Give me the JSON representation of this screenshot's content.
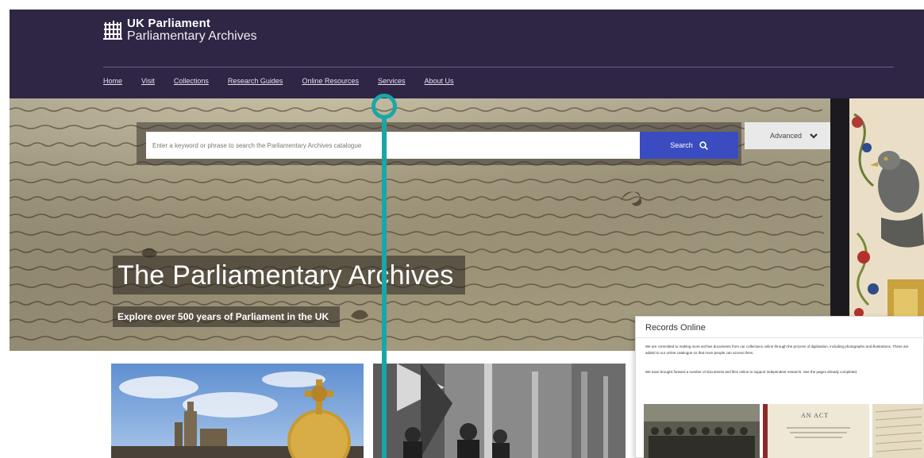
{
  "brand": {
    "title": "UK Parliament",
    "subtitle": "Parliamentary Archives"
  },
  "nav": {
    "items": [
      {
        "label": "Home"
      },
      {
        "label": "Visit"
      },
      {
        "label": "Collections"
      },
      {
        "label": "Research Guides"
      },
      {
        "label": "Online Resources"
      },
      {
        "label": "Services"
      },
      {
        "label": "About Us"
      }
    ]
  },
  "search": {
    "placeholder": "Enter a keyword or phrase to search the Parliamentary Archives catalogue",
    "button_label": "Search",
    "advanced_label": "Advanced"
  },
  "hero": {
    "title": "The Parliamentary Archives",
    "subtitle": "Explore over 500 years of Parliament in the UK"
  },
  "records_online": {
    "title": "Records Online",
    "paragraph_1": "We are committed to making more archive documents from our collections online through the process of digitisation, including photographs and illustrations. These are added to our online catalogue so that more people can access them.",
    "paragraph_2": "We have brought forward a number of documents and files online to support independent research. See the pages already completed.",
    "thumb_label": "AN ACT"
  },
  "icons": {
    "logo": "portcullis-icon",
    "search": "search-icon",
    "advanced": "chevron-down-icon"
  },
  "colors": {
    "header_bg": "#2f2545",
    "search_button": "#3a4cc0",
    "annotation": "#1aa6a8"
  }
}
